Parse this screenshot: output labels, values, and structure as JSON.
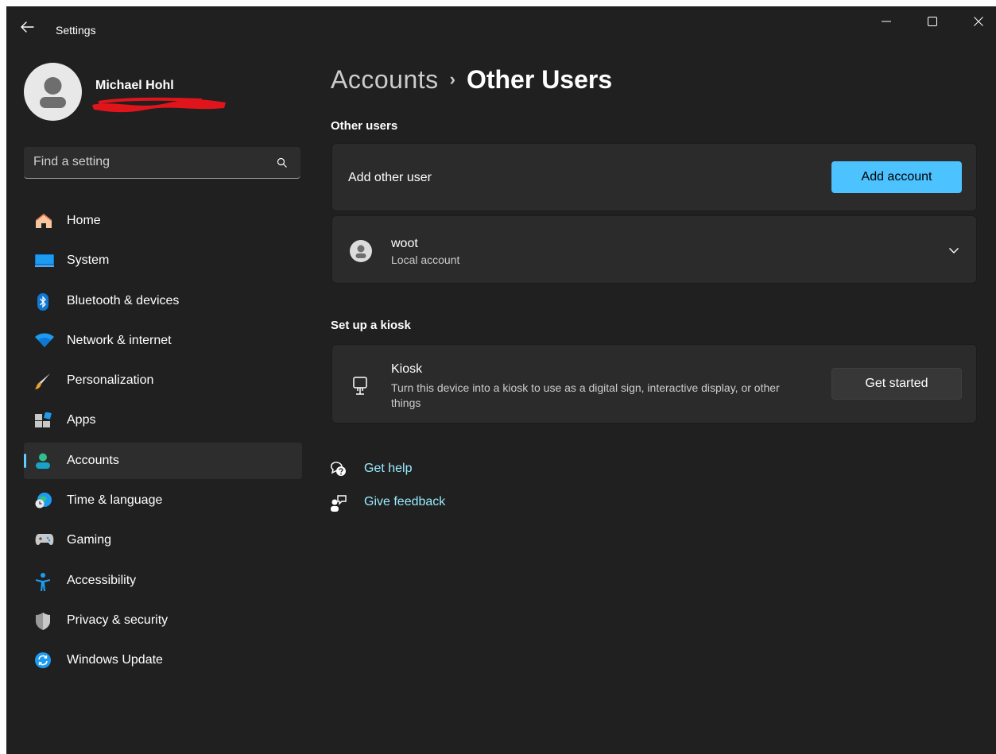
{
  "window": {
    "title": "Settings",
    "controls": [
      "minimize",
      "maximize",
      "close"
    ]
  },
  "profile": {
    "name": "Michael Hohl"
  },
  "search": {
    "placeholder": "Find a setting"
  },
  "sidebar": {
    "items": [
      {
        "label": "Home",
        "icon": "home-icon",
        "active": false
      },
      {
        "label": "System",
        "icon": "system-icon",
        "active": false
      },
      {
        "label": "Bluetooth & devices",
        "icon": "bluetooth-icon",
        "active": false
      },
      {
        "label": "Network & internet",
        "icon": "wifi-icon",
        "active": false
      },
      {
        "label": "Personalization",
        "icon": "brush-icon",
        "active": false
      },
      {
        "label": "Apps",
        "icon": "apps-icon",
        "active": false
      },
      {
        "label": "Accounts",
        "icon": "accounts-icon",
        "active": true
      },
      {
        "label": "Time & language",
        "icon": "globe-clock-icon",
        "active": false
      },
      {
        "label": "Gaming",
        "icon": "gamepad-icon",
        "active": false
      },
      {
        "label": "Accessibility",
        "icon": "accessibility-icon",
        "active": false
      },
      {
        "label": "Privacy & security",
        "icon": "shield-icon",
        "active": false
      },
      {
        "label": "Windows Update",
        "icon": "update-icon",
        "active": false
      }
    ]
  },
  "breadcrumb": {
    "parent": "Accounts",
    "separator": "›",
    "current": "Other Users"
  },
  "other_users": {
    "section_title": "Other users",
    "add_label": "Add other user",
    "add_button": "Add account",
    "users": [
      {
        "name": "woot",
        "type": "Local account"
      }
    ]
  },
  "kiosk": {
    "section_title": "Set up a kiosk",
    "title": "Kiosk",
    "description": "Turn this device into a kiosk to use as a digital sign, interactive display, or other things",
    "button": "Get started"
  },
  "links": {
    "help": "Get help",
    "feedback": "Give feedback"
  },
  "colors": {
    "background": "#202020",
    "card": "#2b2b2b",
    "accent": "#4cc2ff",
    "link": "#99ebff"
  }
}
